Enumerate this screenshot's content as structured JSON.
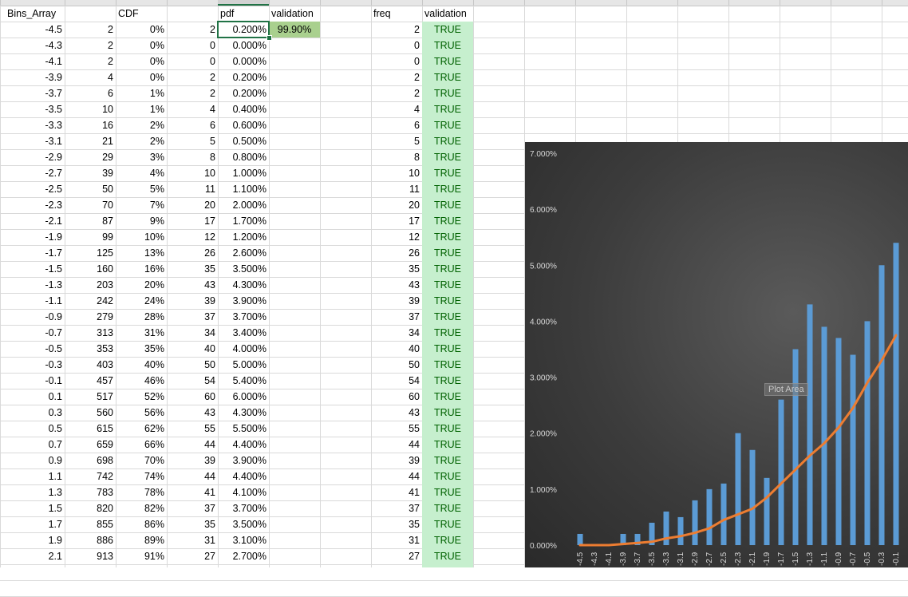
{
  "headers": {
    "bins": "Bins_Array",
    "cdf": "CDF",
    "pdf": "pdf",
    "validation1": "validation",
    "freq": "freq",
    "validation2": "validation"
  },
  "pdf_validation": "99.90%",
  "rows": [
    {
      "bin": "-4.5",
      "cum": "2",
      "cdf": "0%",
      "cnt": "2",
      "pdf": "0.200%",
      "freq": "2",
      "val": "TRUE"
    },
    {
      "bin": "-4.3",
      "cum": "2",
      "cdf": "0%",
      "cnt": "0",
      "pdf": "0.000%",
      "freq": "0",
      "val": "TRUE"
    },
    {
      "bin": "-4.1",
      "cum": "2",
      "cdf": "0%",
      "cnt": "0",
      "pdf": "0.000%",
      "freq": "0",
      "val": "TRUE"
    },
    {
      "bin": "-3.9",
      "cum": "4",
      "cdf": "0%",
      "cnt": "2",
      "pdf": "0.200%",
      "freq": "2",
      "val": "TRUE"
    },
    {
      "bin": "-3.7",
      "cum": "6",
      "cdf": "1%",
      "cnt": "2",
      "pdf": "0.200%",
      "freq": "2",
      "val": "TRUE"
    },
    {
      "bin": "-3.5",
      "cum": "10",
      "cdf": "1%",
      "cnt": "4",
      "pdf": "0.400%",
      "freq": "4",
      "val": "TRUE"
    },
    {
      "bin": "-3.3",
      "cum": "16",
      "cdf": "2%",
      "cnt": "6",
      "pdf": "0.600%",
      "freq": "6",
      "val": "TRUE"
    },
    {
      "bin": "-3.1",
      "cum": "21",
      "cdf": "2%",
      "cnt": "5",
      "pdf": "0.500%",
      "freq": "5",
      "val": "TRUE"
    },
    {
      "bin": "-2.9",
      "cum": "29",
      "cdf": "3%",
      "cnt": "8",
      "pdf": "0.800%",
      "freq": "8",
      "val": "TRUE"
    },
    {
      "bin": "-2.7",
      "cum": "39",
      "cdf": "4%",
      "cnt": "10",
      "pdf": "1.000%",
      "freq": "10",
      "val": "TRUE"
    },
    {
      "bin": "-2.5",
      "cum": "50",
      "cdf": "5%",
      "cnt": "11",
      "pdf": "1.100%",
      "freq": "11",
      "val": "TRUE"
    },
    {
      "bin": "-2.3",
      "cum": "70",
      "cdf": "7%",
      "cnt": "20",
      "pdf": "2.000%",
      "freq": "20",
      "val": "TRUE"
    },
    {
      "bin": "-2.1",
      "cum": "87",
      "cdf": "9%",
      "cnt": "17",
      "pdf": "1.700%",
      "freq": "17",
      "val": "TRUE"
    },
    {
      "bin": "-1.9",
      "cum": "99",
      "cdf": "10%",
      "cnt": "12",
      "pdf": "1.200%",
      "freq": "12",
      "val": "TRUE"
    },
    {
      "bin": "-1.7",
      "cum": "125",
      "cdf": "13%",
      "cnt": "26",
      "pdf": "2.600%",
      "freq": "26",
      "val": "TRUE"
    },
    {
      "bin": "-1.5",
      "cum": "160",
      "cdf": "16%",
      "cnt": "35",
      "pdf": "3.500%",
      "freq": "35",
      "val": "TRUE"
    },
    {
      "bin": "-1.3",
      "cum": "203",
      "cdf": "20%",
      "cnt": "43",
      "pdf": "4.300%",
      "freq": "43",
      "val": "TRUE"
    },
    {
      "bin": "-1.1",
      "cum": "242",
      "cdf": "24%",
      "cnt": "39",
      "pdf": "3.900%",
      "freq": "39",
      "val": "TRUE"
    },
    {
      "bin": "-0.9",
      "cum": "279",
      "cdf": "28%",
      "cnt": "37",
      "pdf": "3.700%",
      "freq": "37",
      "val": "TRUE"
    },
    {
      "bin": "-0.7",
      "cum": "313",
      "cdf": "31%",
      "cnt": "34",
      "pdf": "3.400%",
      "freq": "34",
      "val": "TRUE"
    },
    {
      "bin": "-0.5",
      "cum": "353",
      "cdf": "35%",
      "cnt": "40",
      "pdf": "4.000%",
      "freq": "40",
      "val": "TRUE"
    },
    {
      "bin": "-0.3",
      "cum": "403",
      "cdf": "40%",
      "cnt": "50",
      "pdf": "5.000%",
      "freq": "50",
      "val": "TRUE"
    },
    {
      "bin": "-0.1",
      "cum": "457",
      "cdf": "46%",
      "cnt": "54",
      "pdf": "5.400%",
      "freq": "54",
      "val": "TRUE"
    },
    {
      "bin": "0.1",
      "cum": "517",
      "cdf": "52%",
      "cnt": "60",
      "pdf": "6.000%",
      "freq": "60",
      "val": "TRUE"
    },
    {
      "bin": "0.3",
      "cum": "560",
      "cdf": "56%",
      "cnt": "43",
      "pdf": "4.300%",
      "freq": "43",
      "val": "TRUE"
    },
    {
      "bin": "0.5",
      "cum": "615",
      "cdf": "62%",
      "cnt": "55",
      "pdf": "5.500%",
      "freq": "55",
      "val": "TRUE"
    },
    {
      "bin": "0.7",
      "cum": "659",
      "cdf": "66%",
      "cnt": "44",
      "pdf": "4.400%",
      "freq": "44",
      "val": "TRUE"
    },
    {
      "bin": "0.9",
      "cum": "698",
      "cdf": "70%",
      "cnt": "39",
      "pdf": "3.900%",
      "freq": "39",
      "val": "TRUE"
    },
    {
      "bin": "1.1",
      "cum": "742",
      "cdf": "74%",
      "cnt": "44",
      "pdf": "4.400%",
      "freq": "44",
      "val": "TRUE"
    },
    {
      "bin": "1.3",
      "cum": "783",
      "cdf": "78%",
      "cnt": "41",
      "pdf": "4.100%",
      "freq": "41",
      "val": "TRUE"
    },
    {
      "bin": "1.5",
      "cum": "820",
      "cdf": "82%",
      "cnt": "37",
      "pdf": "3.700%",
      "freq": "37",
      "val": "TRUE"
    },
    {
      "bin": "1.7",
      "cum": "855",
      "cdf": "86%",
      "cnt": "35",
      "pdf": "3.500%",
      "freq": "35",
      "val": "TRUE"
    },
    {
      "bin": "1.9",
      "cum": "886",
      "cdf": "89%",
      "cnt": "31",
      "pdf": "3.100%",
      "freq": "31",
      "val": "TRUE"
    },
    {
      "bin": "2.1",
      "cum": "913",
      "cdf": "91%",
      "cnt": "27",
      "pdf": "2.700%",
      "freq": "27",
      "val": "TRUE"
    }
  ],
  "chart": {
    "tooltip": "Plot Area"
  },
  "chart_data": {
    "type": "bar",
    "categories": [
      "-4.5",
      "-4.3",
      "-4.1",
      "-3.9",
      "-3.7",
      "-3.5",
      "-3.3",
      "-3.1",
      "-2.9",
      "-2.7",
      "-2.5",
      "-2.3",
      "-2.1",
      "-1.9",
      "-1.7",
      "-1.5",
      "-1.3",
      "-1.1",
      "-0.9",
      "-0.7",
      "-0.5",
      "-0.3",
      "-0.1"
    ],
    "series": [
      {
        "type": "bar",
        "values": [
          0.2,
          0.0,
          0.0,
          0.2,
          0.2,
          0.4,
          0.6,
          0.5,
          0.8,
          1.0,
          1.1,
          2.0,
          1.7,
          1.2,
          2.6,
          3.5,
          4.3,
          3.9,
          3.7,
          3.4,
          4.0,
          5.0,
          5.4
        ]
      },
      {
        "type": "line",
        "values": [
          0.0,
          0.0,
          0.0,
          0.02,
          0.04,
          0.06,
          0.12,
          0.16,
          0.22,
          0.3,
          0.45,
          0.55,
          0.65,
          0.85,
          1.1,
          1.35,
          1.6,
          1.82,
          2.1,
          2.45,
          2.9,
          3.3,
          3.75
        ]
      }
    ],
    "yticks": [
      "0.000%",
      "1.000%",
      "2.000%",
      "3.000%",
      "4.000%",
      "5.000%",
      "6.000%",
      "7.000%"
    ],
    "ylim": [
      0,
      7
    ],
    "colors": {
      "bar": "#5b9bd5",
      "line": "#ed7d31",
      "background": "#404040",
      "text": "#d9d9d9"
    }
  }
}
